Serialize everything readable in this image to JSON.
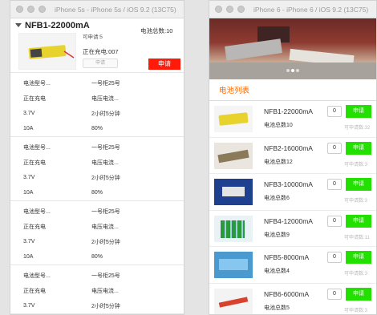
{
  "left_window": {
    "title": "iPhone 5s - iPhone 5s / iOS 9.2 (13C75)",
    "header": {
      "battery_name": "NFB1-22000mA",
      "total_label": "电池总数:10",
      "available_label": "可申请:5",
      "charging_label": "正在充电:007",
      "cancel_label": "申请",
      "apply_label": "申请"
    },
    "info_blocks": [
      {
        "rows": [
          [
            "电池型号...",
            "一号柜25号"
          ],
          [
            "正在充电",
            "电压电流..."
          ],
          [
            "3.7V",
            "2小时5分钟"
          ],
          [
            "10A",
            "80%"
          ]
        ]
      },
      {
        "rows": [
          [
            "电池型号...",
            "一号柜25号"
          ],
          [
            "正在充电",
            "电压电流..."
          ],
          [
            "3.7V",
            "2小时5分钟"
          ],
          [
            "10A",
            "80%"
          ]
        ]
      },
      {
        "rows": [
          [
            "电池型号...",
            "一号柜25号"
          ],
          [
            "正在充电",
            "电压电流..."
          ],
          [
            "3.7V",
            "2小时5分钟"
          ],
          [
            "10A",
            "80%"
          ]
        ]
      },
      {
        "rows": [
          [
            "电池型号...",
            "一号柜25号"
          ],
          [
            "正在充电",
            "电压电流..."
          ],
          [
            "3.7V",
            "2小时5分钟"
          ]
        ]
      }
    ]
  },
  "right_window": {
    "title": "iPhone 6 - iPhone 6 / iOS 9.2 (13C75)",
    "section_title": "电池列表",
    "batteries": [
      {
        "name": "NFB1-22000mA",
        "total": "电池总数10",
        "qty": "0",
        "apply": "申请",
        "available": "可申请数:32",
        "thumb": "thumb-yellow"
      },
      {
        "name": "NFB2-16000mA",
        "total": "电池总数12",
        "qty": "0",
        "apply": "申请",
        "available": "可申请数:3",
        "thumb": "thumb-grey"
      },
      {
        "name": "NFB3-10000mA",
        "total": "电池总数6",
        "qty": "0",
        "apply": "申请",
        "available": "可申请数:3",
        "thumb": "thumb-blue"
      },
      {
        "name": "NFB4-12000mA",
        "total": "电池总数9",
        "qty": "0",
        "apply": "申请",
        "available": "可申请数:11",
        "thumb": "thumb-green"
      },
      {
        "name": "NFB5-8000mA",
        "total": "电池总数4",
        "qty": "0",
        "apply": "申请",
        "available": "可申请数:3",
        "thumb": "thumb-sky"
      },
      {
        "name": "NFB6-6000mA",
        "total": "电池总数5",
        "qty": "0",
        "apply": "申请",
        "available": "可申请数:3",
        "thumb": "thumb-white"
      }
    ]
  },
  "colors": {
    "accent_orange": "#ff6a00",
    "apply_red": "#ff1a0a",
    "apply_green": "#22e000"
  }
}
